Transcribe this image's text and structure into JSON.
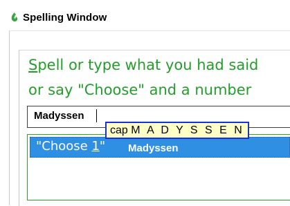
{
  "window": {
    "title": "Spelling Window",
    "icon": "dragon-flame-icon",
    "accent_color": "#239e2a"
  },
  "prompt": {
    "line1_underlined": "S",
    "line1_rest": "pell or type what you had said",
    "line2": "or say \"Choose\" and a number"
  },
  "entry": {
    "value": "Madyssen"
  },
  "tooltip": {
    "prefix": "cap",
    "letters": "M A D Y S S E N"
  },
  "list": {
    "items": [
      {
        "choose_prefix": "\"Choose ",
        "choose_number": "1",
        "choose_suffix": "\"",
        "word": "Madyssen",
        "selected": true
      }
    ],
    "selection_color": "#2f8fe3"
  }
}
